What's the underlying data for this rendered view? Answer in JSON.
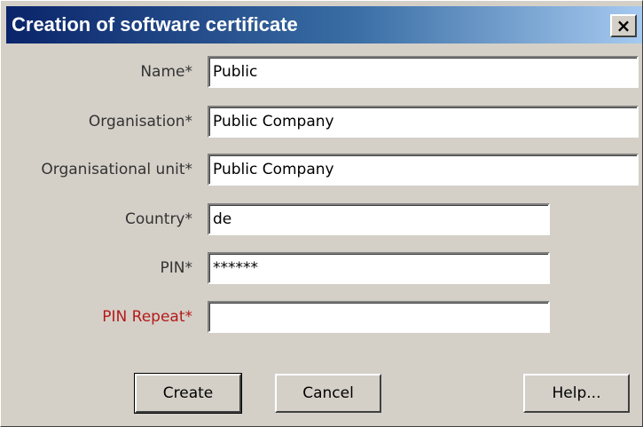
{
  "window": {
    "title": "Creation of software certificate",
    "close_label": "×"
  },
  "form": {
    "fields": [
      {
        "label": "Name*",
        "value": "Public"
      },
      {
        "label": "Organisation*",
        "value": "Public Company"
      },
      {
        "label": "Organisational unit*",
        "value": "Public Company"
      },
      {
        "label": "Country*",
        "value": "de"
      },
      {
        "label": "PIN*",
        "value": "******"
      },
      {
        "label": "PIN Repeat*",
        "value": ""
      }
    ]
  },
  "buttons": {
    "create": "Create",
    "cancel": "Cancel",
    "help": "Help..."
  },
  "colors": {
    "title_gradient_start": "#0a246a",
    "required_highlight": "#b51a1a"
  }
}
